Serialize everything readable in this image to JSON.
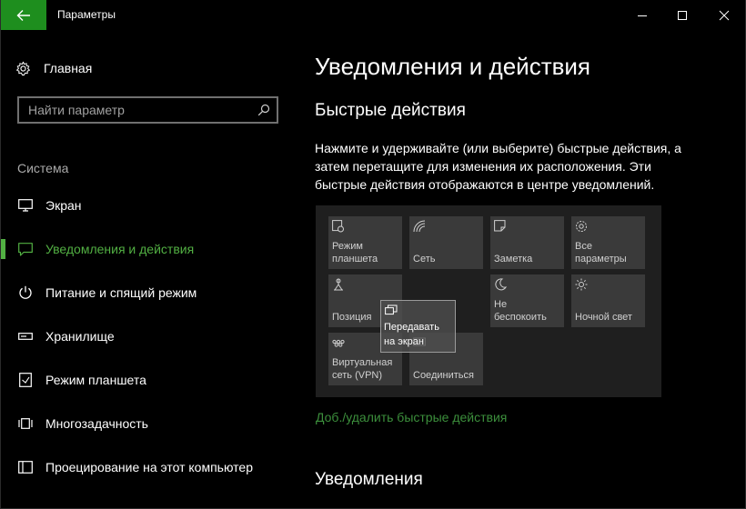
{
  "window": {
    "title": "Параметры"
  },
  "sidebar": {
    "home_label": "Главная",
    "search_placeholder": "Найти параметр",
    "section_label": "Система",
    "items": [
      {
        "label": "Экран",
        "icon": "monitor-icon"
      },
      {
        "label": "Уведомления и действия",
        "icon": "notification-icon",
        "active": true
      },
      {
        "label": "Питание и спящий режим",
        "icon": "power-icon"
      },
      {
        "label": "Хранилище",
        "icon": "storage-icon"
      },
      {
        "label": "Режим планшета",
        "icon": "tablet-mode-icon"
      },
      {
        "label": "Многозадачность",
        "icon": "multitasking-icon"
      },
      {
        "label": "Проецирование на этот компьютер",
        "icon": "projecting-icon"
      }
    ]
  },
  "main": {
    "title": "Уведомления и действия",
    "quick_actions_heading": "Быстрые действия",
    "description_lines": [
      "Нажмите и удерживайте (или выберите) быстрые действия, а",
      "затем перетащите для изменения их расположения. Эти",
      "быстрые действия отображаются в центре уведомлений."
    ],
    "tiles": [
      {
        "line1": "Режим",
        "line2": "планшета",
        "icon": "tablet-mode-icon"
      },
      {
        "line1": "",
        "line2": "Сеть",
        "icon": "network-icon"
      },
      {
        "line1": "",
        "line2": "Заметка",
        "icon": "note-icon"
      },
      {
        "line1": "Все",
        "line2": "параметры",
        "icon": "settings-gear-icon"
      },
      {
        "line1": "",
        "line2": "Позиция",
        "icon": "location-icon"
      },
      {
        "line1": "Не",
        "line2": "беспокоить",
        "icon": "moon-icon"
      },
      {
        "line1": "",
        "line2": "Ночной свет",
        "icon": "brightness-icon"
      },
      {
        "line1": "Виртуальная",
        "line2": "сеть (VPN)",
        "icon": "vpn-icon"
      },
      {
        "line1": "",
        "line2": "Соединиться",
        "icon": "connect-icon"
      }
    ],
    "dragging_tile": {
      "line1": "Передавать",
      "line2": "на экран",
      "icon": "project-icon"
    },
    "add_remove_link": "Доб./удалить быстрые действия",
    "notifications_heading": "Уведомления"
  },
  "colors": {
    "accent": "#52b043",
    "back_button": "#1e8e1e",
    "link": "#3c8f3c",
    "tile": "#3a3a3a",
    "panel": "#1f1f1f"
  }
}
